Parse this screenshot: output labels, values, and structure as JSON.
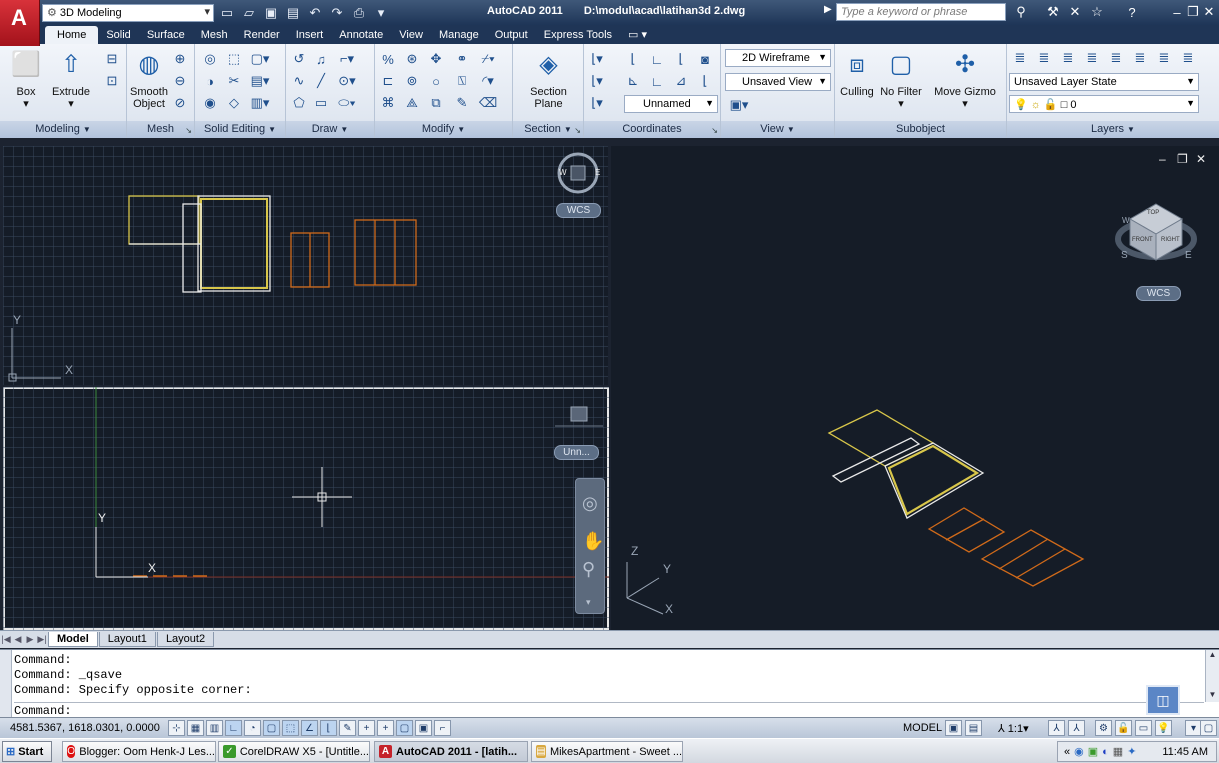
{
  "title_bar": {
    "workspace": "3D Modeling",
    "app_name": "AutoCAD 2011",
    "file_path": "D:\\modul\\acad\\latihan3d 2.dwg",
    "search_placeholder": "Type a keyword or phrase"
  },
  "ribbon_tabs": [
    "Home",
    "Solid",
    "Surface",
    "Mesh",
    "Render",
    "Insert",
    "Annotate",
    "View",
    "Manage",
    "Output",
    "Express Tools"
  ],
  "ribbon": {
    "modeling": {
      "label": "Modeling",
      "box": "Box",
      "extrude": "Extrude"
    },
    "mesh": {
      "label": "Mesh",
      "smooth_object_line1": "Smooth",
      "smooth_object_line2": "Object"
    },
    "solid_editing": {
      "label": "Solid Editing"
    },
    "draw": {
      "label": "Draw"
    },
    "modify": {
      "label": "Modify"
    },
    "section": {
      "label": "Section",
      "plane_line1": "Section",
      "plane_line2": "Plane"
    },
    "coordinates": {
      "label": "Coordinates",
      "ucs_name": "Unnamed"
    },
    "view": {
      "label": "View",
      "visual_style": "2D Wireframe",
      "saved_view": "Unsaved View"
    },
    "subobject": {
      "label": "Subobject",
      "culling": "Culling",
      "no_filter": "No Filter",
      "move_gizmo": "Move Gizmo"
    },
    "layers": {
      "label": "Layers",
      "layer_state": "Unsaved Layer State",
      "current_layer": "0"
    }
  },
  "viewports": {
    "top_left": {
      "wcs": "WCS",
      "axis_y": "Y",
      "axis_x": "X",
      "compass": {
        "w": "W",
        "e": "E"
      }
    },
    "bottom_left": {
      "ucs": "Unn...",
      "axis_y": "Y",
      "axis_x": "X"
    },
    "right": {
      "wcs": "WCS",
      "axis_z": "Z",
      "axis_y": "Y",
      "axis_x": "X",
      "cube": {
        "top": "TOP",
        "front": "FRONT",
        "right": "RIGHT",
        "s": "S",
        "e": "E",
        "w": "W"
      }
    }
  },
  "layout_tabs": [
    "Model",
    "Layout1",
    "Layout2"
  ],
  "command_line": {
    "history": [
      "Command:",
      "Command: _qsave",
      "Command: Specify opposite corner:"
    ],
    "prompt": "Command:"
  },
  "status_bar": {
    "coordinates": "4581.5367, 1618.0301, 0.0000",
    "space": "MODEL",
    "annotation_scale": "1:1"
  },
  "taskbar": {
    "start": "Start",
    "tasks": [
      "Blogger: Oom Henk-J Les...",
      "CorelDRAW X5 - [Untitle...",
      "AutoCAD 2011 - [latih...",
      "MikesApartment - Sweet ..."
    ],
    "clock": "11:45 AM"
  },
  "colors": {
    "title_bar": "#1e3557",
    "canvas": "#151c27",
    "geometry_yellow": "#d8c64a",
    "geometry_orange": "#d06a1a",
    "geometry_white": "#e8e8e8"
  }
}
